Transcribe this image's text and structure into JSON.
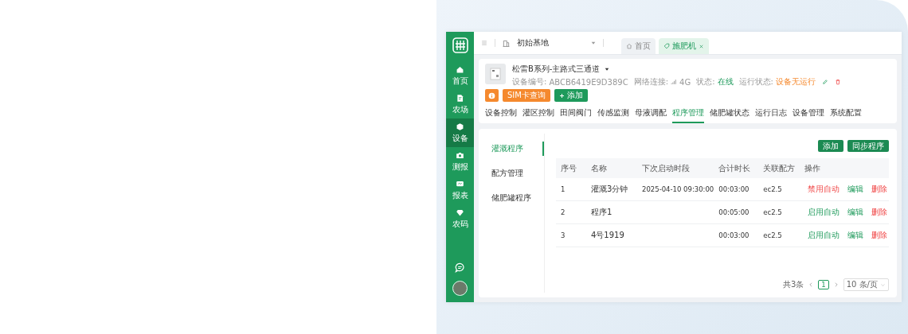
{
  "sidebar": {
    "items": [
      {
        "label": "首页",
        "selected": false
      },
      {
        "label": "农场",
        "selected": false
      },
      {
        "label": "设备",
        "selected": true
      },
      {
        "label": "测报",
        "selected": false
      },
      {
        "label": "报表",
        "selected": false
      },
      {
        "label": "农码",
        "selected": false
      }
    ]
  },
  "topbar": {
    "base": "初始基地",
    "tabs": [
      {
        "label": "首页",
        "closable": false,
        "selected": false
      },
      {
        "label": "施肥机",
        "closable": true,
        "selected": true
      }
    ]
  },
  "device": {
    "title": "松雷B系列-主路式三通道",
    "serial_label": "设备编号:",
    "serial": "ABCB6419E9D389C",
    "network_label": "网络连接:",
    "network": "4G",
    "status_label": "状态:",
    "status": "在线",
    "run_label": "运行状态:",
    "run_status": "设备无运行",
    "buttons": [
      {
        "label": "SIM卡查询",
        "kind": "warning"
      },
      {
        "label": "添加",
        "kind": "primary"
      }
    ]
  },
  "tabs": [
    {
      "label": "设备控制",
      "selected": false
    },
    {
      "label": "灌区控制",
      "selected": false
    },
    {
      "label": "田间阀门",
      "selected": false
    },
    {
      "label": "传感监测",
      "selected": false
    },
    {
      "label": "母液调配",
      "selected": false
    },
    {
      "label": "程序管理",
      "selected": true
    },
    {
      "label": "储肥罐状态",
      "selected": false
    },
    {
      "label": "运行日志",
      "selected": false
    },
    {
      "label": "设备管理",
      "selected": false
    },
    {
      "label": "系统配置",
      "selected": false
    }
  ],
  "subnav": [
    {
      "label": "灌溉程序",
      "selected": true
    },
    {
      "label": "配方管理",
      "selected": false
    },
    {
      "label": "储肥罐程序",
      "selected": false
    }
  ],
  "toolbar": [
    "添加",
    "同步程序"
  ],
  "table": {
    "columns": [
      "序号",
      "名称",
      "下次启动时段",
      "合计时长",
      "关联配方",
      "操作"
    ],
    "rows": [
      {
        "cells": [
          "1",
          "灌溉3分钟",
          "2025-04-10 09:30:00",
          "00:03:00",
          "ec2.5"
        ],
        "actions": [
          {
            "label": "禁用自动",
            "kind": "danger"
          },
          {
            "label": "编辑",
            "kind": "primary"
          },
          {
            "label": "删除",
            "kind": "danger"
          }
        ]
      },
      {
        "cells": [
          "2",
          "程序1",
          "",
          "00:05:00",
          "ec2.5"
        ],
        "actions": [
          {
            "label": "启用自动",
            "kind": "primary"
          },
          {
            "label": "编辑",
            "kind": "primary"
          },
          {
            "label": "删除",
            "kind": "danger"
          }
        ]
      },
      {
        "cells": [
          "3",
          "4号1919",
          "",
          "00:03:00",
          "ec2.5"
        ],
        "actions": [
          {
            "label": "启用自动",
            "kind": "primary"
          },
          {
            "label": "编辑",
            "kind": "primary"
          },
          {
            "label": "删除",
            "kind": "danger"
          }
        ]
      }
    ]
  },
  "pagination": {
    "total": "共3条",
    "page": "1",
    "page_size": "10 条/页"
  }
}
